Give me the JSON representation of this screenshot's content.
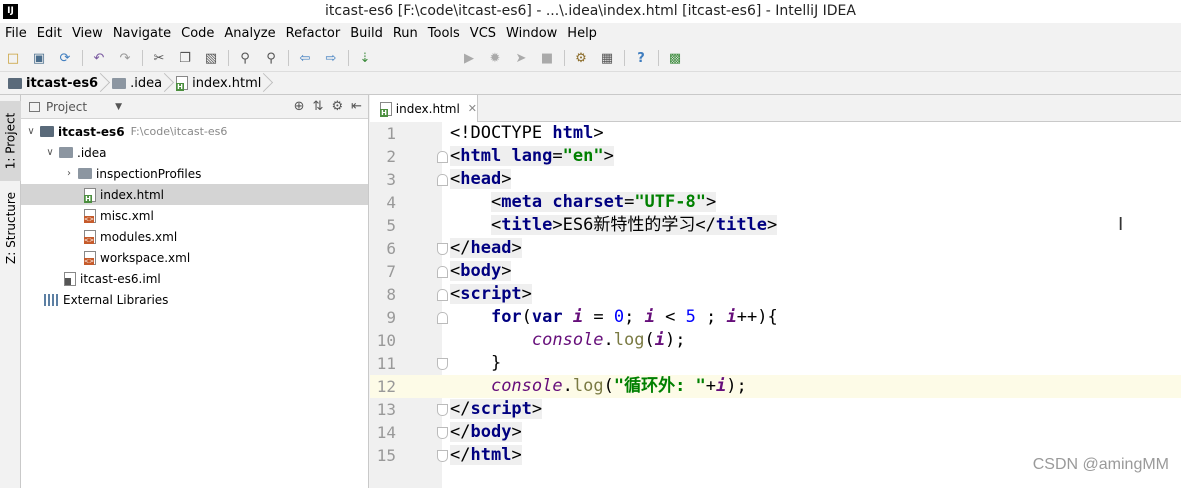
{
  "window": {
    "app_icon": "IJ",
    "title": "itcast-es6 [F:\\code\\itcast-es6] - ...\\.idea\\index.html [itcast-es6] - IntelliJ IDEA"
  },
  "menu": [
    "File",
    "Edit",
    "View",
    "Navigate",
    "Code",
    "Analyze",
    "Refactor",
    "Build",
    "Run",
    "Tools",
    "VCS",
    "Window",
    "Help"
  ],
  "breadcrumb": [
    "itcast-es6",
    ".idea",
    "index.html"
  ],
  "side_tabs": {
    "project": "1: Project",
    "structure": "Z: Structure"
  },
  "project_panel": {
    "title": "Project",
    "root": {
      "name": "itcast-es6",
      "path": "F:\\code\\itcast-es6"
    },
    "items": [
      {
        "label": ".idea"
      },
      {
        "label": "inspectionProfiles"
      },
      {
        "label": "index.html"
      },
      {
        "label": "misc.xml"
      },
      {
        "label": "modules.xml"
      },
      {
        "label": "workspace.xml"
      },
      {
        "label": "itcast-es6.iml"
      },
      {
        "label": "External Libraries"
      }
    ]
  },
  "editor": {
    "tab_label": "index.html",
    "line_numbers": [
      "1",
      "2",
      "3",
      "4",
      "5",
      "6",
      "7",
      "8",
      "9",
      "10",
      "11",
      "12",
      "13",
      "14",
      "15"
    ],
    "title_text": "ES6新特性的学习",
    "log_string": "\"循环外: \""
  },
  "watermark": "CSDN @amingMM"
}
